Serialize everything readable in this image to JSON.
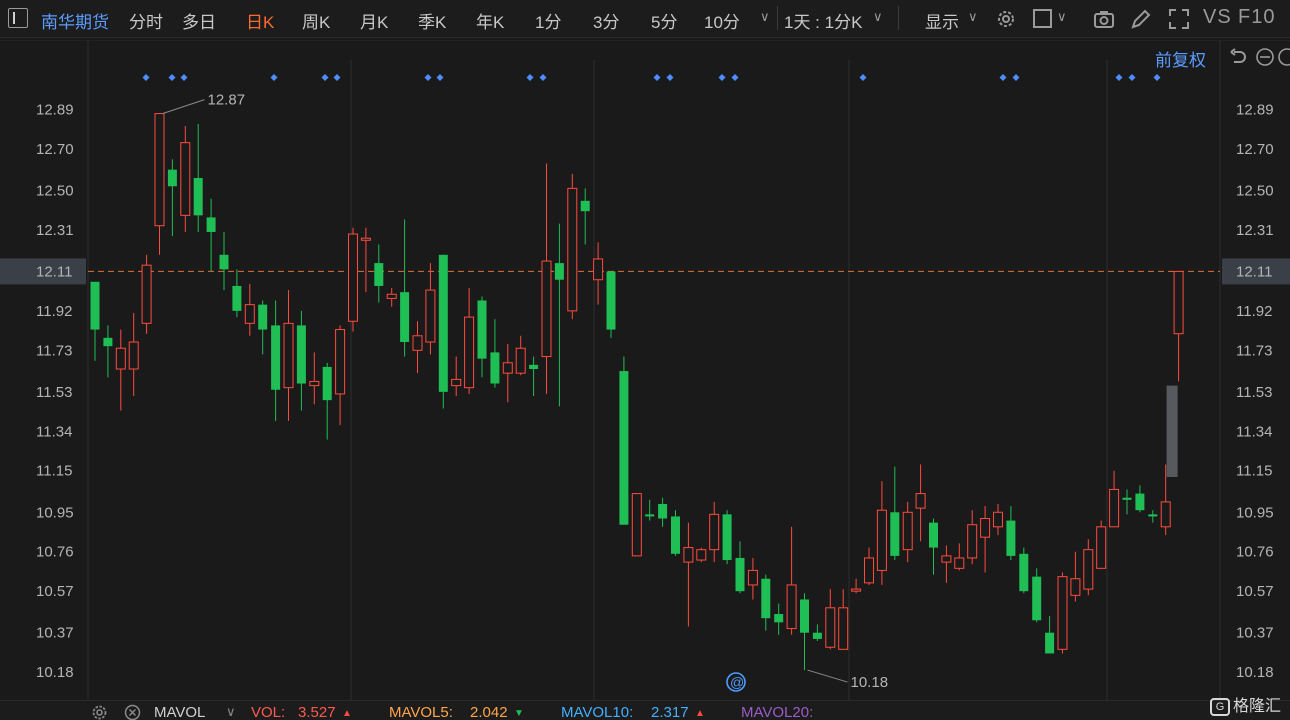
{
  "toolbar": {
    "stock_name": "南华期货",
    "periods": [
      "分时",
      "多日",
      "日K",
      "周K",
      "月K",
      "季K",
      "年K",
      "1分",
      "3分",
      "5分",
      "10分"
    ],
    "active_period": "日K",
    "interval_select": "1天 : 1分K",
    "display_label": "显示",
    "vs_label": "VS",
    "f10_label": "F10"
  },
  "subheader": {
    "adjust_label": "前复权"
  },
  "chart_data": {
    "type": "candlestick",
    "y_ticks": [
      "12.89",
      "12.70",
      "12.50",
      "12.31",
      "12.11",
      "11.92",
      "11.73",
      "11.53",
      "11.34",
      "11.15",
      "10.95",
      "10.76",
      "10.57",
      "10.37",
      "10.18"
    ],
    "ylim": [
      10.07,
      13.08
    ],
    "current_price": "12.11",
    "high_label": "12.87",
    "low_label": "10.18",
    "colors": {
      "up": "#ff4b3e",
      "down": "#1fbf55",
      "current_line": "#e0703a",
      "marker": "#4d8dff"
    },
    "candles": [
      {
        "o": 12.06,
        "c": 11.83,
        "h": 12.06,
        "l": 11.68
      },
      {
        "o": 11.79,
        "c": 11.75,
        "h": 11.85,
        "l": 11.6
      },
      {
        "o": 11.64,
        "c": 11.74,
        "h": 11.83,
        "l": 11.44
      },
      {
        "o": 11.64,
        "c": 11.77,
        "h": 11.91,
        "l": 11.51
      },
      {
        "o": 11.86,
        "c": 12.14,
        "h": 12.19,
        "l": 11.81
      },
      {
        "o": 12.33,
        "c": 12.87,
        "h": 12.87,
        "l": 12.19
      },
      {
        "o": 12.6,
        "c": 12.52,
        "h": 12.65,
        "l": 12.28
      },
      {
        "o": 12.38,
        "c": 12.73,
        "h": 12.81,
        "l": 12.3
      },
      {
        "o": 12.56,
        "c": 12.38,
        "h": 12.82,
        "l": 12.3
      },
      {
        "o": 12.37,
        "c": 12.3,
        "h": 12.46,
        "l": 12.11
      },
      {
        "o": 12.19,
        "c": 12.12,
        "h": 12.3,
        "l": 12.02
      },
      {
        "o": 12.04,
        "c": 11.92,
        "h": 12.12,
        "l": 11.89
      },
      {
        "o": 11.86,
        "c": 11.95,
        "h": 12.05,
        "l": 11.8
      },
      {
        "o": 11.95,
        "c": 11.83,
        "h": 11.97,
        "l": 11.71
      },
      {
        "o": 11.85,
        "c": 11.54,
        "h": 11.97,
        "l": 11.39
      },
      {
        "o": 11.55,
        "c": 11.86,
        "h": 12.02,
        "l": 11.39
      },
      {
        "o": 11.85,
        "c": 11.57,
        "h": 11.92,
        "l": 11.44
      },
      {
        "o": 11.56,
        "c": 11.58,
        "h": 11.72,
        "l": 11.47
      },
      {
        "o": 11.65,
        "c": 11.49,
        "h": 11.67,
        "l": 11.3
      },
      {
        "o": 11.52,
        "c": 11.83,
        "h": 11.85,
        "l": 11.37
      },
      {
        "o": 11.87,
        "c": 12.29,
        "h": 12.32,
        "l": 11.82
      },
      {
        "o": 12.26,
        "c": 12.27,
        "h": 12.32,
        "l": 12.01
      },
      {
        "o": 12.15,
        "c": 12.04,
        "h": 12.24,
        "l": 11.96
      },
      {
        "o": 11.98,
        "c": 12.0,
        "h": 12.03,
        "l": 11.94
      },
      {
        "o": 12.01,
        "c": 11.77,
        "h": 12.36,
        "l": 11.7
      },
      {
        "o": 11.73,
        "c": 11.8,
        "h": 11.87,
        "l": 11.62
      },
      {
        "o": 11.77,
        "c": 12.02,
        "h": 12.15,
        "l": 11.71
      },
      {
        "o": 12.19,
        "c": 11.53,
        "h": 12.19,
        "l": 11.45
      },
      {
        "o": 11.56,
        "c": 11.59,
        "h": 11.7,
        "l": 11.51
      },
      {
        "o": 11.55,
        "c": 11.89,
        "h": 12.03,
        "l": 11.52
      },
      {
        "o": 11.97,
        "c": 11.69,
        "h": 11.99,
        "l": 11.6
      },
      {
        "o": 11.72,
        "c": 11.57,
        "h": 11.88,
        "l": 11.55
      },
      {
        "o": 11.62,
        "c": 11.67,
        "h": 11.76,
        "l": 11.48
      },
      {
        "o": 11.62,
        "c": 11.74,
        "h": 11.8,
        "l": 11.61
      },
      {
        "o": 11.66,
        "c": 11.64,
        "h": 11.7,
        "l": 11.51
      },
      {
        "o": 11.7,
        "c": 12.16,
        "h": 12.63,
        "l": 11.52
      },
      {
        "o": 12.15,
        "c": 12.07,
        "h": 12.34,
        "l": 11.46
      },
      {
        "o": 11.92,
        "c": 12.51,
        "h": 12.58,
        "l": 11.88
      },
      {
        "o": 12.45,
        "c": 12.4,
        "h": 12.51,
        "l": 12.24
      },
      {
        "o": 12.07,
        "c": 12.17,
        "h": 12.25,
        "l": 11.95
      },
      {
        "o": 12.11,
        "c": 11.83,
        "h": 12.11,
        "l": 11.79
      },
      {
        "o": 11.63,
        "c": 10.89,
        "h": 11.7,
        "l": 10.89
      },
      {
        "o": 10.74,
        "c": 11.04,
        "h": 11.04,
        "l": 10.74
      },
      {
        "o": 10.94,
        "c": 10.93,
        "h": 11.01,
        "l": 10.91
      },
      {
        "o": 10.99,
        "c": 10.92,
        "h": 11.02,
        "l": 10.88
      },
      {
        "o": 10.93,
        "c": 10.75,
        "h": 10.96,
        "l": 10.74
      },
      {
        "o": 10.71,
        "c": 10.78,
        "h": 10.9,
        "l": 10.4
      },
      {
        "o": 10.72,
        "c": 10.77,
        "h": 10.78,
        "l": 10.71
      },
      {
        "o": 10.77,
        "c": 10.94,
        "h": 11.0,
        "l": 10.71
      },
      {
        "o": 10.94,
        "c": 10.72,
        "h": 10.96,
        "l": 10.7
      },
      {
        "o": 10.73,
        "c": 10.57,
        "h": 10.81,
        "l": 10.56
      },
      {
        "o": 10.6,
        "c": 10.67,
        "h": 10.73,
        "l": 10.53
      },
      {
        "o": 10.63,
        "c": 10.44,
        "h": 10.65,
        "l": 10.38
      },
      {
        "o": 10.46,
        "c": 10.42,
        "h": 10.51,
        "l": 10.36
      },
      {
        "o": 10.39,
        "c": 10.6,
        "h": 10.88,
        "l": 10.36
      },
      {
        "o": 10.53,
        "c": 10.37,
        "h": 10.56,
        "l": 10.19
      },
      {
        "o": 10.37,
        "c": 10.34,
        "h": 10.41,
        "l": 10.33
      },
      {
        "o": 10.3,
        "c": 10.49,
        "h": 10.58,
        "l": 10.29
      },
      {
        "o": 10.29,
        "c": 10.49,
        "h": 10.58,
        "l": 10.29
      },
      {
        "o": 10.57,
        "c": 10.58,
        "h": 10.63,
        "l": 10.56
      },
      {
        "o": 10.61,
        "c": 10.73,
        "h": 10.78,
        "l": 10.6
      },
      {
        "o": 10.67,
        "c": 10.96,
        "h": 11.1,
        "l": 10.6
      },
      {
        "o": 10.95,
        "c": 10.74,
        "h": 11.17,
        "l": 10.72
      },
      {
        "o": 10.77,
        "c": 10.95,
        "h": 11.0,
        "l": 10.71
      },
      {
        "o": 10.97,
        "c": 11.04,
        "h": 11.18,
        "l": 10.81
      },
      {
        "o": 10.9,
        "c": 10.78,
        "h": 10.92,
        "l": 10.65
      },
      {
        "o": 10.71,
        "c": 10.74,
        "h": 10.79,
        "l": 10.61
      },
      {
        "o": 10.68,
        "c": 10.73,
        "h": 10.8,
        "l": 10.67
      },
      {
        "o": 10.73,
        "c": 10.89,
        "h": 10.96,
        "l": 10.7
      },
      {
        "o": 10.83,
        "c": 10.92,
        "h": 10.98,
        "l": 10.66
      },
      {
        "o": 10.88,
        "c": 10.95,
        "h": 10.99,
        "l": 10.84
      },
      {
        "o": 10.91,
        "c": 10.74,
        "h": 10.98,
        "l": 10.72
      },
      {
        "o": 10.75,
        "c": 10.57,
        "h": 10.78,
        "l": 10.56
      },
      {
        "o": 10.64,
        "c": 10.43,
        "h": 10.68,
        "l": 10.42
      },
      {
        "o": 10.37,
        "c": 10.27,
        "h": 10.45,
        "l": 10.27
      },
      {
        "o": 10.29,
        "c": 10.64,
        "h": 10.66,
        "l": 10.27
      },
      {
        "o": 10.55,
        "c": 10.63,
        "h": 10.76,
        "l": 10.52
      },
      {
        "o": 10.58,
        "c": 10.77,
        "h": 10.82,
        "l": 10.55
      },
      {
        "o": 10.68,
        "c": 10.88,
        "h": 10.91,
        "l": 10.68
      },
      {
        "o": 10.88,
        "c": 11.06,
        "h": 11.15,
        "l": 10.88
      },
      {
        "o": 11.02,
        "c": 11.01,
        "h": 11.06,
        "l": 10.94
      },
      {
        "o": 11.04,
        "c": 10.96,
        "h": 11.08,
        "l": 10.95
      },
      {
        "o": 10.94,
        "c": 10.93,
        "h": 10.96,
        "l": 10.9
      },
      {
        "o": 10.88,
        "c": 11.0,
        "h": 11.18,
        "l": 10.84
      },
      {
        "o": 11.81,
        "c": 12.11,
        "h": 12.11,
        "l": 11.58
      }
    ],
    "blue_markers": [
      4,
      6,
      7,
      11,
      13,
      14,
      18,
      19,
      22,
      23,
      27,
      28,
      32,
      33,
      38,
      40,
      43,
      44,
      49,
      50,
      54
    ],
    "info_icon": "@"
  },
  "bottom_bar": {
    "indicator_name": "MAVOL",
    "vol_label": "VOL:",
    "vol_value": "3.527",
    "mavol5_label": "MAVOL5:",
    "mavol5_value": "2.042",
    "mavol10_label": "MAVOL10:",
    "mavol10_value": "2.317",
    "mavol20_label": "MAVOL20:"
  },
  "logo": {
    "mark": "G",
    "text": "格隆汇"
  }
}
